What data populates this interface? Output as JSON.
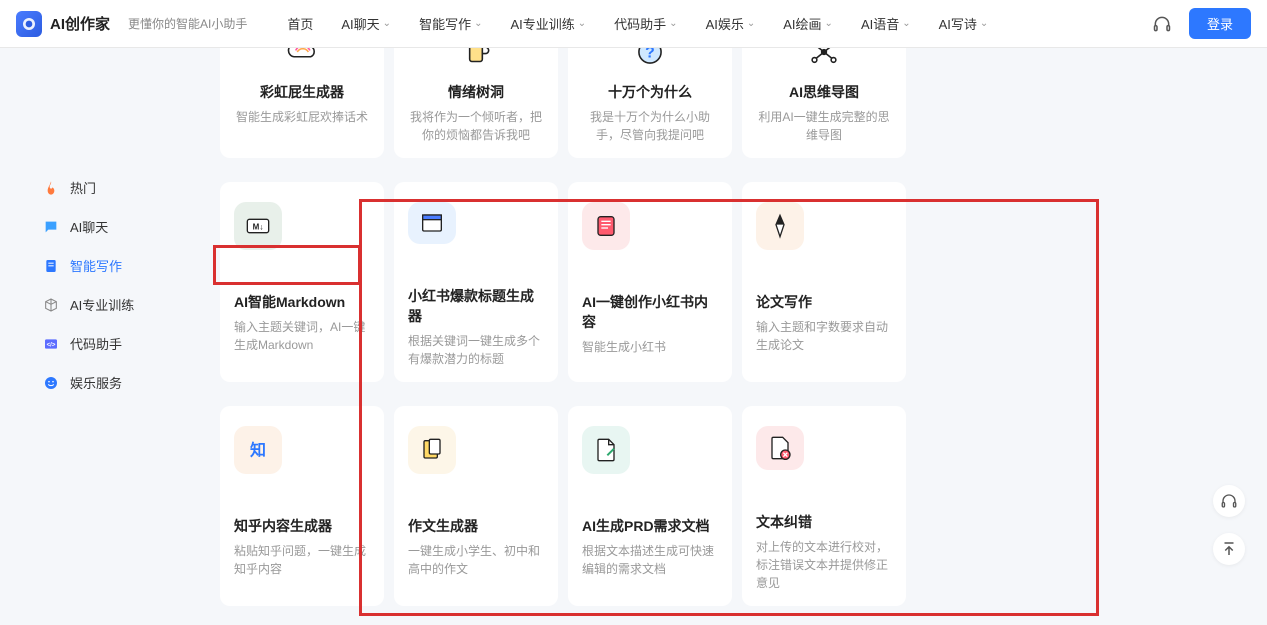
{
  "brand": {
    "name": "AI创作家",
    "slogan": "更懂你的智能AI小助手"
  },
  "nav": {
    "items": [
      {
        "label": "首页",
        "dropdown": false
      },
      {
        "label": "AI聊天",
        "dropdown": true
      },
      {
        "label": "智能写作",
        "dropdown": true
      },
      {
        "label": "AI专业训练",
        "dropdown": true
      },
      {
        "label": "代码助手",
        "dropdown": true
      },
      {
        "label": "AI娱乐",
        "dropdown": true
      },
      {
        "label": "AI绘画",
        "dropdown": true
      },
      {
        "label": "AI语音",
        "dropdown": true
      },
      {
        "label": "AI写诗",
        "dropdown": true
      }
    ]
  },
  "login_label": "登录",
  "sidebar": {
    "items": [
      {
        "label": "热门",
        "icon": "fire",
        "color": "#ff7a3d"
      },
      {
        "label": "AI聊天",
        "icon": "chat",
        "color": "#3aa0ff"
      },
      {
        "label": "智能写作",
        "icon": "doc",
        "color": "#2d78ff"
      },
      {
        "label": "AI专业训练",
        "icon": "cube",
        "color": "#888"
      },
      {
        "label": "代码助手",
        "icon": "code",
        "color": "#5b6cff"
      },
      {
        "label": "娱乐服务",
        "icon": "smile",
        "color": "#2d78ff"
      }
    ]
  },
  "row1": [
    {
      "title": "彩虹屁生成器",
      "desc": "智能生成彩虹屁欢捧话术",
      "icon": "cloud"
    },
    {
      "title": "情绪树洞",
      "desc": "我将作为一个倾听者，把你的烦恼都告诉我吧",
      "icon": "cup"
    },
    {
      "title": "十万个为什么",
      "desc": "我是十万个为什么小助手，尽管向我提问吧",
      "icon": "question"
    },
    {
      "title": "AI思维导图",
      "desc": "利用AI一键生成完整的思维导图",
      "icon": "mindmap"
    }
  ],
  "row2": [
    {
      "title": "AI智能Markdown",
      "desc": "输入主题关键词，AI一键生成Markdown",
      "icon": "md",
      "bg": "#e8f0ea"
    },
    {
      "title": "小红书爆款标题生成器",
      "desc": "根据关键词一键生成多个有爆款潜力的标题",
      "icon": "window",
      "bg": "#e8f2fe"
    },
    {
      "title": "AI一键创作小红书内容",
      "desc": "智能生成小红书",
      "icon": "note",
      "bg": "#fde9ea"
    },
    {
      "title": "论文写作",
      "desc": "输入主题和字数要求自动生成论文",
      "icon": "pen",
      "bg": "#fdf2e8"
    }
  ],
  "row3": [
    {
      "title": "知乎内容生成器",
      "desc": "粘贴知乎问题，一键生成知乎内容",
      "icon": "zhi",
      "bg": "#fdf2e8"
    },
    {
      "title": "作文生成器",
      "desc": "一键生成小学生、初中和高中的作文",
      "icon": "essay",
      "bg": "#fdf6e8"
    },
    {
      "title": "AI生成PRD需求文档",
      "desc": "根据文本描述生成可快速编辑的需求文档",
      "icon": "prd",
      "bg": "#e8f6f2"
    },
    {
      "title": "文本纠错",
      "desc": "对上传的文本进行校对，标注错误文本并提供修正意见",
      "icon": "correct",
      "bg": "#fde9ea"
    }
  ]
}
